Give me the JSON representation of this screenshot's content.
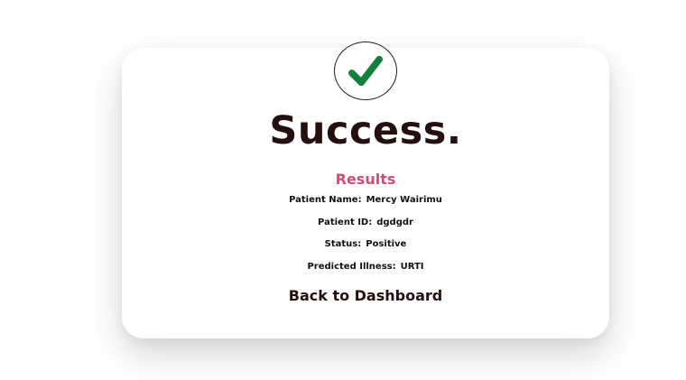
{
  "status": {
    "icon": "check-icon",
    "title": "Success."
  },
  "results": {
    "heading": "Results",
    "patient_name_label": "Patient Name:",
    "patient_name_value": "Mercy Wairimu",
    "patient_id_label": "Patient ID:",
    "patient_id_value": "dgdgdr",
    "status_label": "Status:",
    "status_value": "Positive",
    "illness_label": "Predicted Illness:",
    "illness_value": "URTI"
  },
  "actions": {
    "back_label": "Back to Dashboard"
  },
  "colors": {
    "check": "#157f3e",
    "heading_accent": "#d64a73",
    "title": "#241010"
  }
}
